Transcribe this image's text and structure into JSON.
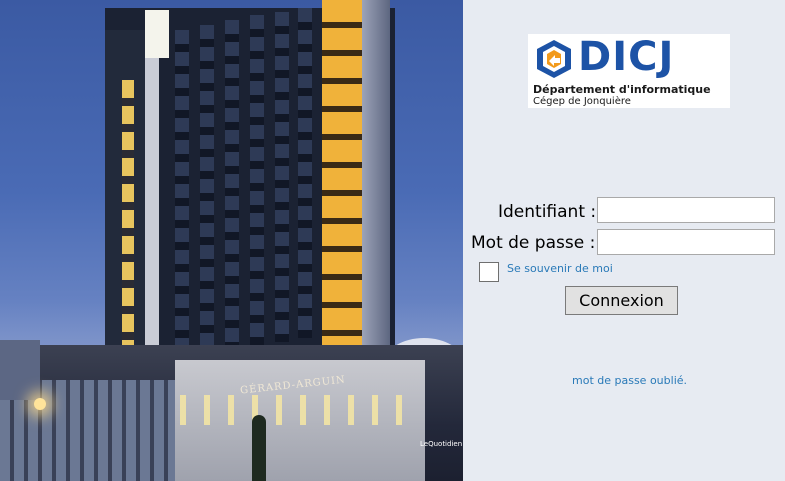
{
  "background_image": {
    "description_icon": "building-photo",
    "sign_text": "GÉRARD-ARGUIN",
    "sign_small_text": "LeQuotidien"
  },
  "logo": {
    "wordmark": "DICJ",
    "line1": "Département d'informatique",
    "line2": "Cégep de Jonquière",
    "color": "#1d53a6"
  },
  "login_form": {
    "username_label": "Identifiant :",
    "username_value": "",
    "password_label": "Mot de passe :",
    "password_value": "",
    "remember_label": "Se souvenir de moi",
    "remember_checked": false,
    "submit_label": "Connexion",
    "forgot_password": "mot de passe oublié."
  },
  "colors": {
    "panel_background": "#e7ebf2",
    "link": "#2a7ab8"
  }
}
